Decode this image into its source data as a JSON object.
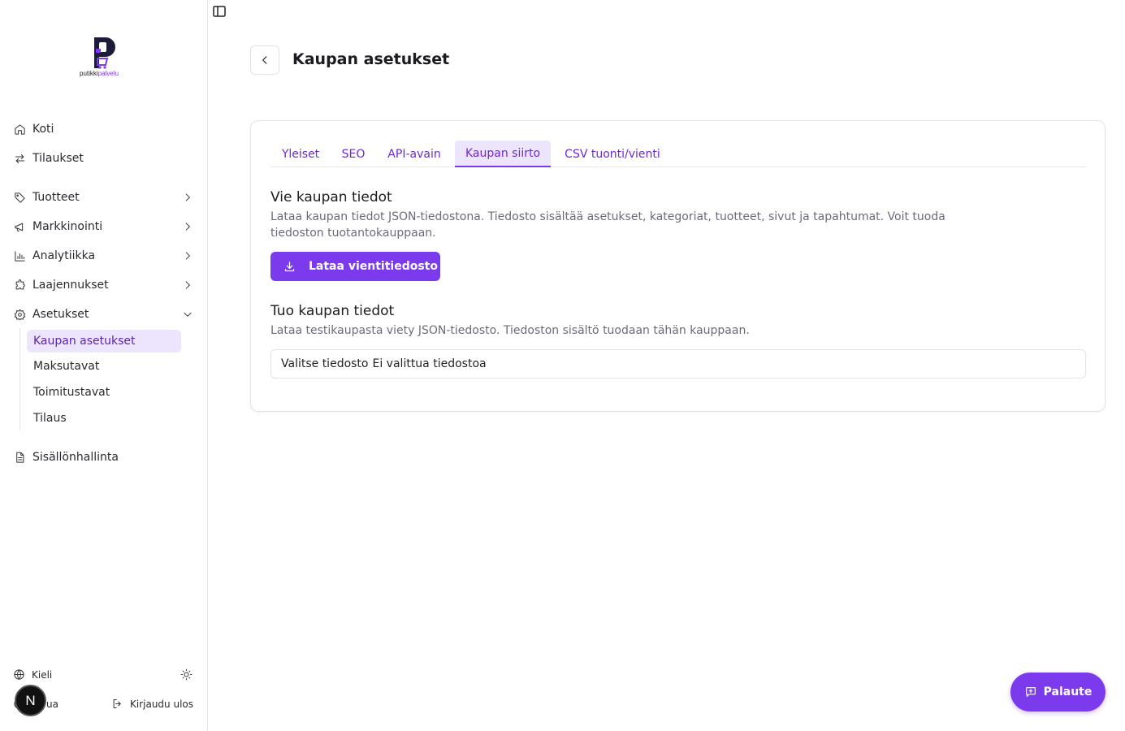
{
  "brand": {
    "name_dark": "putikki",
    "name_accent": "palvelu",
    "accent_color": "#7c3aed"
  },
  "sidebar": {
    "items": [
      {
        "label": "Koti",
        "icon": "home-icon"
      },
      {
        "label": "Tilaukset",
        "icon": "arrows-swap-icon"
      },
      {
        "label": "Tuotteet",
        "icon": "tag-icon",
        "expandable": true
      },
      {
        "label": "Markkinointi",
        "icon": "megaphone-icon",
        "expandable": true
      },
      {
        "label": "Analytiikka",
        "icon": "bar-chart-icon",
        "expandable": true
      },
      {
        "label": "Laajennukset",
        "icon": "puzzle-icon",
        "expandable": true
      },
      {
        "label": "Asetukset",
        "icon": "gear-icon",
        "expanded": true
      },
      {
        "label": "Sisällönhallinta",
        "icon": "document-icon"
      }
    ],
    "settings_sub": [
      {
        "label": "Kaupan asetukset",
        "active": true
      },
      {
        "label": "Maksutavat"
      },
      {
        "label": "Toimitustavat"
      },
      {
        "label": "Tilaus"
      }
    ],
    "footer": {
      "language_label": "Kieli",
      "help_label": "ua",
      "logout_label": "Kirjaudu ulos",
      "avatar_letter": "N"
    }
  },
  "page": {
    "title": "Kaupan asetukset"
  },
  "tabs": [
    {
      "label": "Yleiset"
    },
    {
      "label": "SEO"
    },
    {
      "label": "API-avain"
    },
    {
      "label": "Kaupan siirto",
      "active": true
    },
    {
      "label": "CSV tuonti/vienti"
    }
  ],
  "export": {
    "title": "Vie kaupan tiedot",
    "description": "Lataa kaupan tiedot JSON-tiedostona. Tiedosto sisältää asetukset, kategoriat, tuotteet, sivut ja tapahtumat. Voit tuoda tiedoston tuotantokauppaan.",
    "button_label": "Lataa vientitiedosto"
  },
  "import": {
    "title": "Tuo kaupan tiedot",
    "description": "Lataa testikaupasta viety JSON-tiedosto. Tiedoston sisältö tuodaan tähän kauppaan.",
    "file_button": "Valitse tiedosto",
    "file_status": "Ei valittua tiedostoa"
  },
  "feedback": {
    "label": "Palaute"
  }
}
